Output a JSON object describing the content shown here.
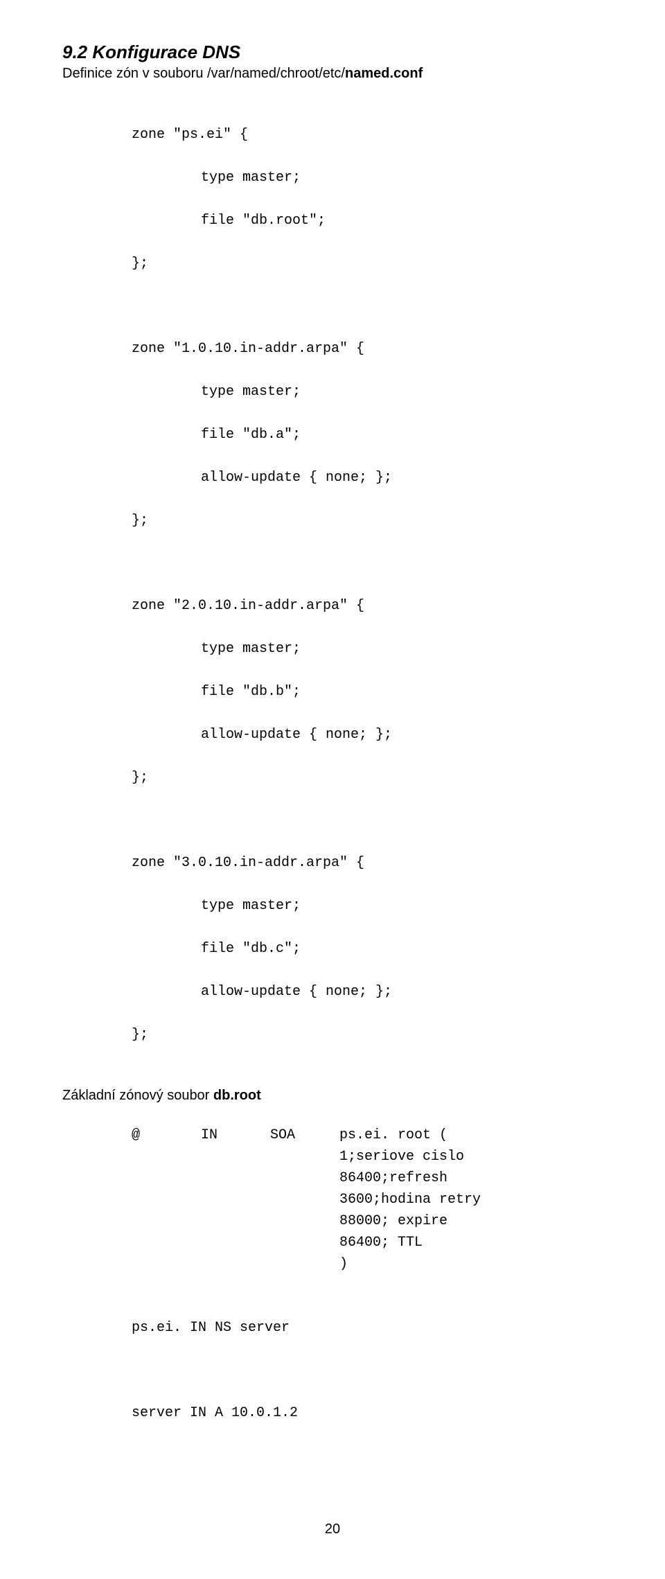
{
  "heading": "9.2 Konfigurace DNS",
  "subheading_plain": "Definice zón v souboru /var/named/chroot/etc/",
  "subheading_bold": "named.conf",
  "zones": [
    {
      "l0": "zone \"ps.ei\" {",
      "l1": "type master;",
      "l2": "file \"db.root\";",
      "end": "};"
    },
    {
      "l0": "zone \"1.0.10.in-addr.arpa\" {",
      "l1": "type master;",
      "l2": "file \"db.a\";",
      "l3": "allow-update { none; };",
      "end": "};"
    },
    {
      "l0": "zone \"2.0.10.in-addr.arpa\" {",
      "l1": "type master;",
      "l2": "file \"db.b\";",
      "l3": "allow-update { none; };",
      "end": "};"
    },
    {
      "l0": "zone \"3.0.10.in-addr.arpa\" {",
      "l1": "type master;",
      "l2": "file \"db.c\";",
      "l3": "allow-update { none; };",
      "end": "};"
    }
  ],
  "zone_file_label_plain": "Základní zónový soubor ",
  "zone_file_label_bold": "db.root",
  "soa": {
    "c1": "@",
    "c2": "IN",
    "c3": "SOA",
    "c4": "ps.ei. root (",
    "details": [
      "1;seriove cislo",
      "86400;refresh",
      "3600;hodina retry",
      "88000; expire",
      "86400; TTL",
      ")"
    ]
  },
  "ns_line": "ps.ei. IN NS server",
  "a_line": "server IN A 10.0.1.2",
  "page_number": "20"
}
